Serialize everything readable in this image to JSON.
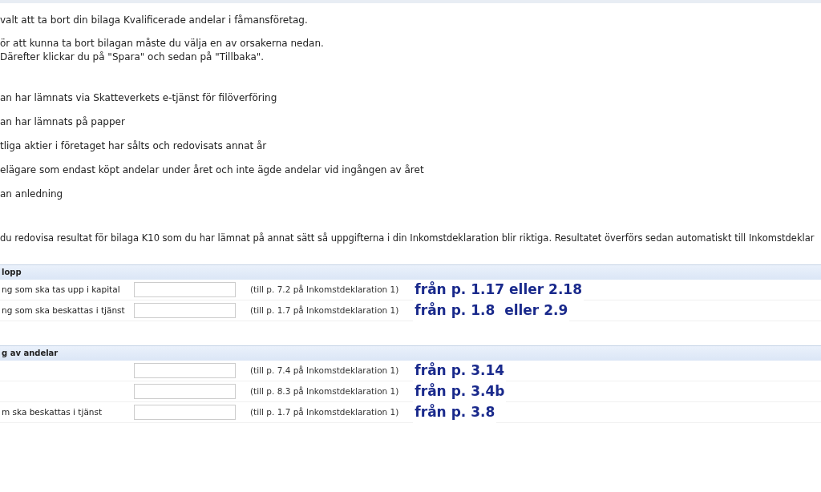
{
  "intro": "valt att ta bort din bilaga Kvalificerade andelar i fåmansföretag.",
  "instructions": [
    "ör att kunna ta bort bilagan måste du välja en av orsakerna nedan.",
    "Därefter klickar du på \"Spara\" och sedan på \"Tillbaka\"."
  ],
  "reasons": [
    "an har lämnats via Skatteverkets e-tjänst för filöverföring",
    "an har lämnats på papper",
    "tliga aktier i företaget har sålts och redovisats annat år",
    "elägare som endast köpt andelar under året och inte ägde andelar vid ingången av året",
    "an anledning"
  ],
  "result_note": "du redovisa resultat för bilaga K10 som du har lämnat på annat sätt så uppgifterna i din Inkomstdeklaration blir riktiga. Resultatet överförs sedan automatiskt till Inkomstdeklar",
  "sections": [
    {
      "title": "lopp",
      "rows": [
        {
          "label": "ng som ska tas upp i kapital",
          "hint": "(till p. 7.2 på Inkomstdeklaration 1)",
          "annotation": "från p. 1.17 eller 2.18"
        },
        {
          "label": "ng som ska beskattas i tjänst",
          "hint": "(till p. 1.7 på Inkomstdeklaration 1)",
          "annotation": "från p. 1.8  eller 2.9"
        }
      ]
    },
    {
      "title": "g av andelar",
      "rows": [
        {
          "hint": "(till p. 7.4 på Inkomstdeklaration 1)",
          "annotation": "från p. 3.14"
        },
        {
          "hint": "(till p. 8.3 på Inkomstdeklaration 1)",
          "annotation": "från p. 3.4b"
        },
        {
          "label": "m ska beskattas i tjänst",
          "hint": "(till p. 1.7 på Inkomstdeklaration 1)",
          "annotation": "från p. 3.8"
        }
      ]
    }
  ]
}
